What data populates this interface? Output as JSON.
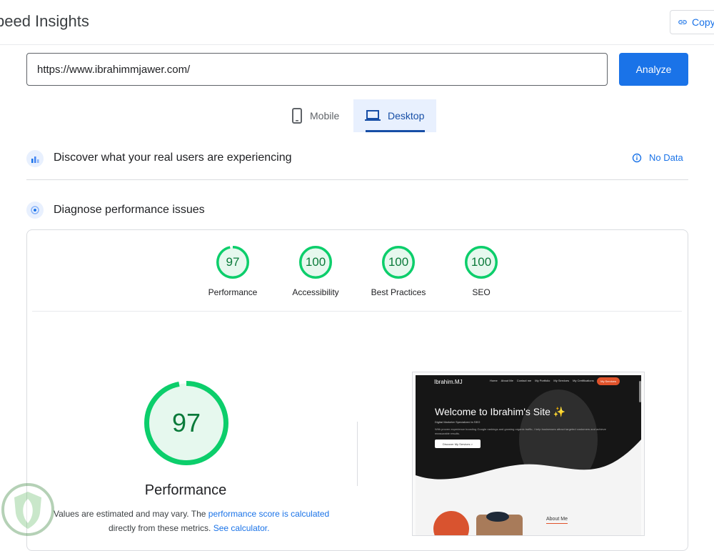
{
  "header": {
    "title": "peed Insights",
    "copy_label": "Copy"
  },
  "search": {
    "url_value": "https://www.ibrahimmjawer.com/",
    "analyze_label": "Analyze"
  },
  "tabs": [
    {
      "label": "Mobile",
      "icon": "phone-icon",
      "selected": false
    },
    {
      "label": "Desktop",
      "icon": "laptop-icon",
      "selected": true
    }
  ],
  "field_data": {
    "title": "Discover what your real users are experiencing",
    "status": "No Data"
  },
  "lab_data": {
    "title": "Diagnose performance issues"
  },
  "scores": [
    {
      "label": "Performance",
      "value": "97",
      "fraction": 0.97
    },
    {
      "label": "Accessibility",
      "value": "100",
      "fraction": 1.0
    },
    {
      "label": "Best Practices",
      "value": "100",
      "fraction": 1.0
    },
    {
      "label": "SEO",
      "value": "100",
      "fraction": 1.0
    }
  ],
  "performance": {
    "score": "97",
    "fraction": 0.97,
    "title": "Performance",
    "note_part1": "Values are estimated and may vary. The ",
    "note_link1": "performance score is calculated",
    "note_part2": "directly from these metrics. ",
    "note_link2": "See calculator."
  },
  "thumbnail": {
    "logo": "Ibrahim.MJ",
    "nav_links": [
      "Home",
      "About Me",
      "Contact me",
      "My Portfolio",
      "My Services",
      "My Certifications"
    ],
    "nav_button": "My Services",
    "hero_title": "Welcome to Ibrahim's Site ✨",
    "hero_subtitle": "Digital Marketer Specialized in SEO",
    "hero_body": "With proven experience boosting Google rankings and growing organic traffic, I help businesses attract targeted customers and achieve measurable results.",
    "cta": "Discover My Services  >",
    "about_heading": "About Me"
  },
  "colors": {
    "pass_green": "#0cce6b",
    "pass_fill": "#e6f8ee",
    "accent_blue": "#1a73e8"
  }
}
